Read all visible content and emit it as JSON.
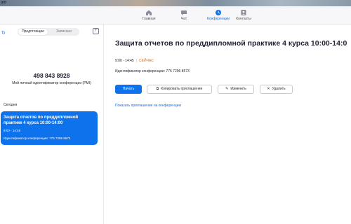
{
  "desktop": {
    "corner_text": "om"
  },
  "nav": {
    "tabs": [
      {
        "label": "Главная",
        "icon": "home-icon",
        "active": false
      },
      {
        "label": "Чат",
        "icon": "chat-icon",
        "active": false
      },
      {
        "label": "Конференции",
        "icon": "clock-icon",
        "active": true
      },
      {
        "label": "Контакты",
        "icon": "contacts-icon",
        "active": false
      }
    ]
  },
  "left": {
    "segments": [
      "Предстоящие",
      "Записано"
    ],
    "pmi_number": "498 843 8928",
    "pmi_label": "Мой личный идентификатор конференции (PMI)",
    "section_today": "Сегодня",
    "meeting_card": {
      "title": "Защита отчетов по преддипломной практике 4 курса 10:00-14:00",
      "time": "9:00 - 14:45",
      "meeting_id": "Идентификатор конференции: 775 7296 8573"
    }
  },
  "detail": {
    "title": "Защита отчетов по преддипломной практике 4 курса 10:00-14:0",
    "time": "9:00 - 14:45",
    "status": "СЕЙЧАС",
    "meeting_id": "Идентификатор конференции: 775 7296 8573",
    "buttons": {
      "start": "Начать",
      "copy_invite": "Копировать приглашение",
      "edit": "Изменить",
      "delete": "Удалить"
    },
    "show_invite_link": "Показать приглашение на конференцию"
  },
  "colors": {
    "accent": "#0e72ed",
    "status_now": "#e07024"
  }
}
